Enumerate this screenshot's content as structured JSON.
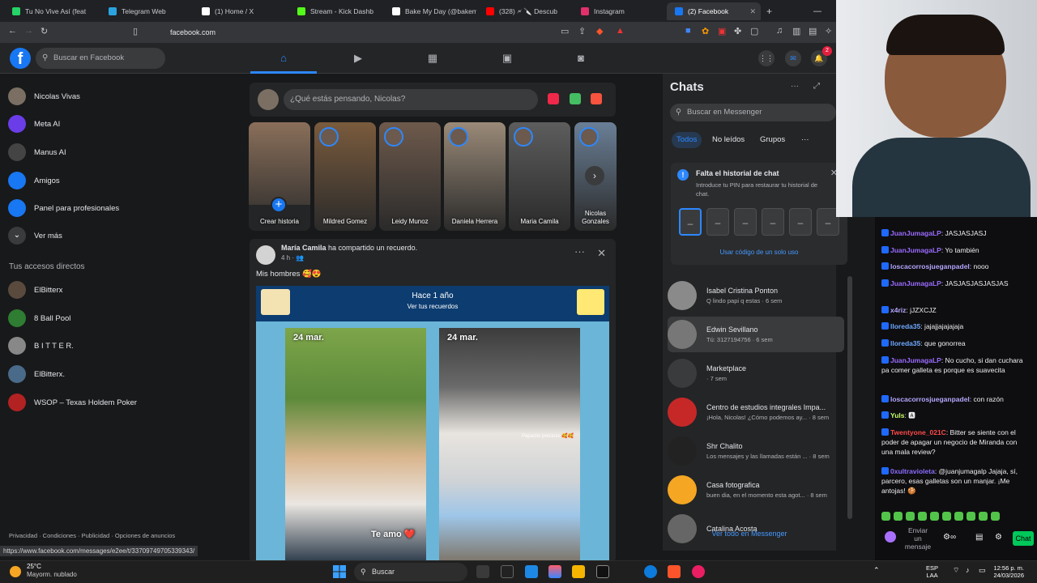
{
  "browser": {
    "tabs": [
      {
        "label": "Tu No Vive Así (feat",
        "color": "#25d366"
      },
      {
        "label": "Telegram Web",
        "color": "#2aa3df"
      },
      {
        "label": "(1) Home / X",
        "color": "#ffffff"
      },
      {
        "label": "Stream - Kick Dashb",
        "color": "#53fc18"
      },
      {
        "label": "Bake My Day (@bakem",
        "color": "#ffffff"
      },
      {
        "label": "(328) 🗲 🔪 Descub",
        "color": "#ff0000"
      },
      {
        "label": "Instagram",
        "color": "#e1306c"
      },
      {
        "label": "(2) Facebook",
        "color": "#1877f2"
      }
    ],
    "url": "facebook.com",
    "status_url": "https://www.facebook.com/messages/e2ee/t/33709749705339343/"
  },
  "fb_header": {
    "logo": "f",
    "search_placeholder": "Buscar en Facebook",
    "nav_icons": [
      "home-icon",
      "video-icon",
      "marketplace-icon",
      "groups-icon",
      "gaming-icon"
    ],
    "notif_count": "2"
  },
  "sidebar": {
    "items": [
      {
        "label": "Nicolas Vivas",
        "icon": "avatar",
        "color": "#7b6f64"
      },
      {
        "label": "Meta AI",
        "icon": "meta-ai-icon",
        "color": "#6a3de8"
      },
      {
        "label": "Manus AI",
        "icon": "manus-icon",
        "color": "#444"
      },
      {
        "label": "Amigos",
        "icon": "friends-icon",
        "color": "#1877f2"
      },
      {
        "label": "Panel para profesionales",
        "icon": "dashboard-icon",
        "color": "#1877f2"
      },
      {
        "label": "Ver más",
        "icon": "chevron-down-icon",
        "color": "#3a3b3c"
      }
    ],
    "shortcuts_title": "Tus accesos directos",
    "shortcuts": [
      {
        "label": "ElBitterx",
        "color": "#5a4a3e"
      },
      {
        "label": "8 Ball Pool",
        "color": "#2e7d32"
      },
      {
        "label": "B I T T E R.",
        "color": "#888"
      },
      {
        "label": "ElBitterx.",
        "color": "#4a6a8a"
      },
      {
        "label": "WSOP – Texas Holdem Poker",
        "color": "#b22222"
      }
    ],
    "footer": "Privacidad · Condiciones · Publicidad · Opciones de anuncios"
  },
  "composer": {
    "placeholder": "¿Qué estás pensando, Nicolas?"
  },
  "stories": [
    {
      "name": "Crear historia",
      "color": "#8a6f5a"
    },
    {
      "name": "Mildred Gomez",
      "color": "#7a5b3d"
    },
    {
      "name": "Leidy Munoz",
      "color": "#6e5a4c"
    },
    {
      "name": "Daniela Herrera",
      "color": "#9a8a78"
    },
    {
      "name": "Maria Camila",
      "color": "#5d5d5d"
    },
    {
      "name": "Nicolas Gonzales",
      "color": "#6a7f96"
    }
  ],
  "post": {
    "author": "María Camila",
    "action": " ha compartido un recuerdo.",
    "time": "4 h · 👥",
    "caption": "Mis hombres 🥰😍",
    "memory_title": "Hace 1 año",
    "memory_link": "Ver tus recuerdos",
    "photos": [
      {
        "date": "24 mar.",
        "overlay": "Te amo ❤️"
      },
      {
        "date": "24 mar.",
        "overlay": "Papacito precioso 🥰🥰"
      }
    ]
  },
  "chats": {
    "title": "Chats",
    "search_placeholder": "Buscar en Messenger",
    "tabs": [
      "Todos",
      "No leídos",
      "Grupos"
    ],
    "pin_title": "Falta el historial de chat",
    "pin_desc": "Introduce tu PIN para restaurar tu historial de chat.",
    "pin_slots": [
      "–",
      "–",
      "–",
      "–",
      "–",
      "–"
    ],
    "pin_otp": "Usar código de un solo uso",
    "list": [
      {
        "name": "Isabel Cristina Ponton",
        "msg": "Q lindo papi q estas · 6 sem",
        "color": "#8a8a8a"
      },
      {
        "name": "Edwin Sevillano",
        "msg": "Tú: 3127194756 · 6 sem",
        "color": "#777"
      },
      {
        "name": "Marketplace",
        "msg": "· 7 sem",
        "color": "#3a3b3c"
      },
      {
        "name": "Centro de estudios integrales Impa...",
        "msg": "¡Hola, Nicolas! ¿Cómo podemos ay... · 8 sem",
        "color": "#c62828"
      },
      {
        "name": "Shr Chalito",
        "msg": "Los mensajes y las llamadas están ... · 8 sem",
        "color": "#222"
      },
      {
        "name": "Casa fotografica",
        "msg": "buen dia, en el momento esta agot... · 8 sem",
        "color": "#f5a623"
      },
      {
        "name": "Catalina Acosta",
        "msg": "",
        "color": "#666"
      }
    ],
    "see_all": "Ver todo en Messenger"
  },
  "twitch": {
    "messages": [
      {
        "user": "JuanJumagaLP",
        "text": ": JASJASJASJ",
        "color": "#9b6bff"
      },
      {
        "user": "JuanJumagaLP",
        "text": ": Yo también",
        "color": "#9b6bff"
      },
      {
        "user": "loscacorrosjueganpadel",
        "text": ": nooo",
        "color": "#b4a7ff"
      },
      {
        "user": "JuanJumagaLP",
        "text": ": JASJASJASJASJAS",
        "color": "#9b6bff"
      },
      {
        "user": "x4riz",
        "text": ": jJZXCJZ",
        "color": "#b4a7ff"
      },
      {
        "user": "lloreda35",
        "text": ": jajajjajajajaja",
        "color": "#6fa8ff"
      },
      {
        "user": "lloreda35",
        "text": ": que gonorrea",
        "color": "#6fa8ff"
      },
      {
        "user": "JuanJumagaLP",
        "text": ": No cucho, si dan cuchara pa comer galleta es porque es suavecita",
        "color": "#9b6bff"
      },
      {
        "user": "loscacorrosjueganpadel",
        "text": ": con razón",
        "color": "#b4a7ff"
      },
      {
        "user": "Yuls",
        "text": ": 🅰",
        "color": "#c8ff6a"
      },
      {
        "user": "Twentyone_021C",
        "text": ": Bitter se siente con el poder de apagar un negocio de Miranda con una mala review?",
        "color": "#ff4a4a"
      },
      {
        "user": "0xultravioleta",
        "text": ": @juanjumagalp Jajaja, sí, parcero, esas galletas son un manjar. ¡Me antojas! 🍪",
        "color": "#8b6bff"
      }
    ],
    "send_label": "Enviar un mensaje",
    "chat_button": "Chat"
  },
  "taskbar": {
    "temp": "25°C",
    "weather": "Mayorm. nublado",
    "search": "Buscar",
    "lang": "ESP",
    "lang2": "LAA",
    "time": "12:56 p. m.",
    "date": "24/03/2026"
  }
}
